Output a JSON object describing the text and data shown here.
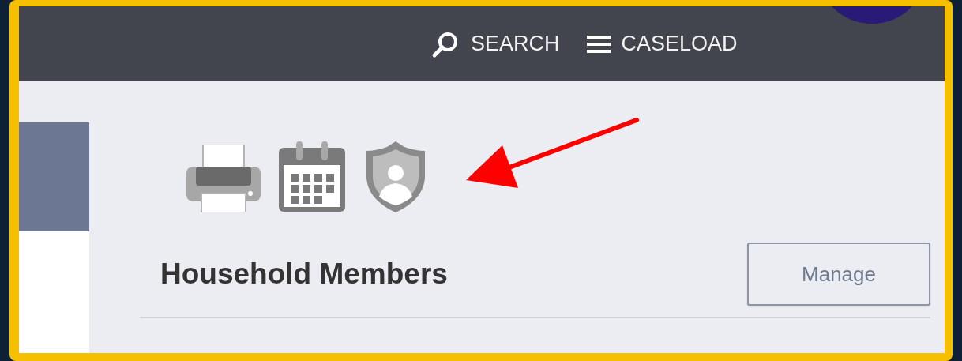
{
  "header": {
    "nav": [
      {
        "kind": "search",
        "label": "SEARCH"
      },
      {
        "kind": "menu",
        "label": "CASELOAD"
      }
    ]
  },
  "section": {
    "title": "Household Members",
    "button": "Manage"
  }
}
